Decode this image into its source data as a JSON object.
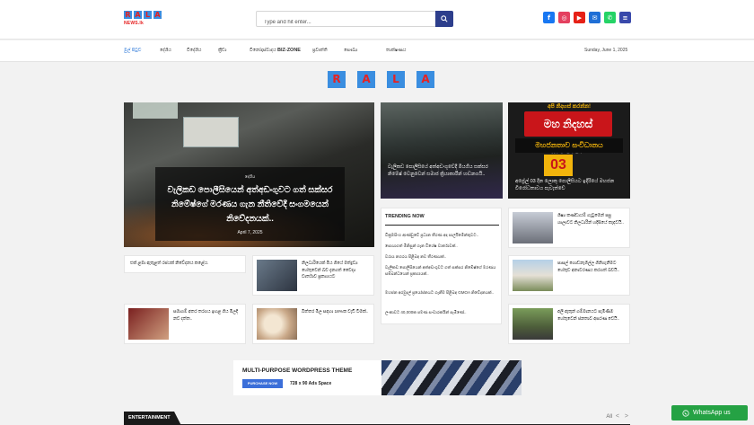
{
  "header": {
    "logo_letters": [
      "R",
      "A",
      "L",
      "A"
    ],
    "logo_sub": "NEWS.lk",
    "search_placeholder": "Type and hit enter...",
    "socials": [
      {
        "name": "facebook",
        "glyph": "f",
        "color": "#1877f2"
      },
      {
        "name": "instagram",
        "glyph": "◎",
        "color": "#e4405f"
      },
      {
        "name": "youtube",
        "glyph": "▶",
        "color": "#e62117"
      },
      {
        "name": "email",
        "glyph": "✉",
        "color": "#1f6fd6"
      },
      {
        "name": "whatsapp",
        "glyph": "✆",
        "color": "#25d366"
      },
      {
        "name": "menu",
        "glyph": "≡",
        "color": "#3949ab"
      }
    ]
  },
  "nav": {
    "items": [
      "මුල් පිටුව",
      "දේශීය",
      "විදේශීය",
      "ක්‍රීඩා",
      "විනෝදාස්වාදය",
      "BIZ-ZONE",
      "ප්‍රවෘත්ති",
      "සෞඛ්‍ය",
      "තාක්ෂණය"
    ],
    "date": "Sunday, June 1, 2025"
  },
  "brand_banner": [
    "R",
    "A",
    "L",
    "A"
  ],
  "hero": {
    "category": "දේශීය",
    "title": "වැලිකඩ පොලීසියෙන් අත්අඩංගුවට ගත් සක්සර නිමේෂ්ගේ මරණය ගැන නීතිවේදී සංගමයෙන් නිවේදනයක්..",
    "date": "April 7, 2025"
  },
  "card2": {
    "title": "වැලිකඩ පොලීසියේ අත්අඩංගුවේදී මියගිය සක්සර නිමේෂ් වෙනුවෙන් සමාජ ක්‍රියාකාරීන් හඬනගයි.."
  },
  "card3": {
    "tag": "අපි නිදහස් කරන්න!",
    "headline": "මහ නිදහස් කරන්න!",
    "strip": "මහජනතාව සංවිධානය",
    "number": "03",
    "title": "අප්‍රේල් 03 දින ලොකු පොලීසියට ඉදිරියේ මහජන විරෝධතාවය පැවැත්වේ"
  },
  "list_left": [
    {
      "text": "එක් ළමා ඇතුළත් රජයක් නිවේදනය කළේය."
    },
    {
      "text": "නිලධාරියෙක් මිය ගියේ මත්ද්‍රව්‍ය හේතුවෙන් බව දැනගත් වෛද්‍ය වාර්තාව ප්‍රකාශයට"
    },
    {
      "text": "සමාගම් අතර තරගය ඉහළ ගිය මිලදී නව දත්ත.."
    },
    {
      "text": "බිත්තර මිල සඳහා 18%ක වැඩි වීමක්.."
    }
  ],
  "trending": {
    "header": "TRENDING NOW",
    "items": [
      "වික්‍රමසිංහ ආණ්ඩුවේ ප්‍රධාන තීරණ අද පාර්ලිමේන්තුවට..",
      "සොයාගත් මිනිසුන් ගැන විශේෂ වාර්තාවක්..",
      "වරාය නගරය පිළිබඳ නව තීරණයක්..",
      "වැලිකඩ පොලීසියෙන් අත්අඩංගුවට ගත් සක්සර නිමේෂ්ගේ මරණය සම්බන්ධයෙන් ප්‍රකාශයක්..",
      "මහජන අරමුදල් ප්‍රයෝජනයට ගැනීම පිළිබඳ GMOA නිවේදනයක්..",
      "ලංකාවට 40,000ක පමණ සංචාරකයින් පැමිණේ.."
    ]
  },
  "list_right": [
    {
      "text": "ශිෂ්‍ය කණ්ඩායම් ගැටුමෙන් පසු ශාලාවට නිලධාරීන් හදිසියේ කැඳවයි.."
    },
    {
      "text": "පාසල් ගොඩනැගිල්ල ගිනිගැනීමට හේතුව අනාවරණය කරගත් බවයි.."
    },
    {
      "text": "අලි ඇතුන් ගම්මානයට පැමිණීම හේතුවෙන් ජනතාව අසරණ වෙයි.."
    }
  ],
  "ad": {
    "heading": "MULTI-PURPOSE WORDPRESS THEME",
    "button": "PURCHASE NOW",
    "size": "728 x 90 Ads Space"
  },
  "section": {
    "label": "ENTERTAINMENT",
    "all": "All",
    "arrows": "< >"
  },
  "whatsapp": {
    "label": "WhatsApp us",
    "color": "#25a244"
  }
}
